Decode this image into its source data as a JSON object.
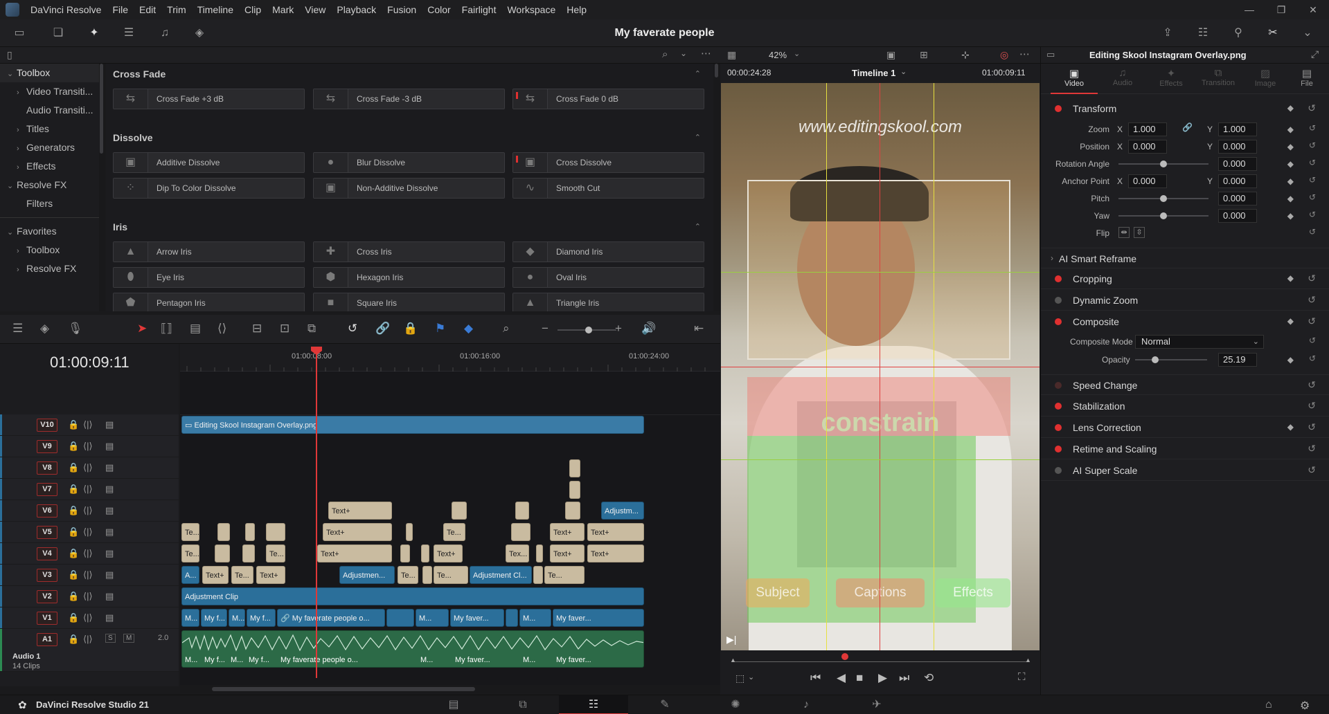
{
  "menu": {
    "app": "DaVinci Resolve",
    "items": [
      "File",
      "Edit",
      "Trim",
      "Timeline",
      "Clip",
      "Mark",
      "View",
      "Playback",
      "Fusion",
      "Color",
      "Fairlight",
      "Workspace",
      "Help"
    ]
  },
  "project_title": "My faverate people",
  "sidebar": {
    "toolbox": "Toolbox",
    "items": [
      "Video Transiti...",
      "Audio Transiti...",
      "Titles",
      "Generators",
      "Effects"
    ],
    "resolve_fx": "Resolve FX",
    "filters": "Filters",
    "favorites": "Favorites",
    "fav_items": [
      "Toolbox",
      "Resolve FX"
    ]
  },
  "transitions": {
    "cross_fade": {
      "title": "Cross Fade",
      "items": [
        "Cross Fade +3 dB",
        "Cross Fade -3 dB",
        "Cross Fade 0 dB"
      ]
    },
    "dissolve": {
      "title": "Dissolve",
      "items": [
        "Additive Dissolve",
        "Blur Dissolve",
        "Cross Dissolve",
        "Dip To Color Dissolve",
        "Non-Additive Dissolve",
        "Smooth Cut"
      ]
    },
    "iris": {
      "title": "Iris",
      "items": [
        "Arrow Iris",
        "Cross Iris",
        "Diamond Iris",
        "Eye Iris",
        "Hexagon Iris",
        "Oval Iris",
        "Pentagon Iris",
        "Square Iris",
        "Triangle Iris"
      ]
    }
  },
  "timeline": {
    "timecode": "01:00:09:11",
    "ruler": [
      "01:00:08:00",
      "01:00:16:00",
      "01:00:24:00"
    ],
    "tracks": [
      "V10",
      "V9",
      "V8",
      "V7",
      "V6",
      "V5",
      "V4",
      "V3",
      "V2",
      "V1",
      "A1"
    ],
    "audio_name": "Audio 1",
    "audio_clips": "14 Clips",
    "audio_level": "2.0",
    "solo": "S",
    "mute": "M",
    "v10_clip": "Editing Skool Instagram Overlay.png",
    "v2_clip": "Adjustment Clip",
    "text_label": "Text+",
    "adj_short": "Adjustm...",
    "adj_short2": "Adjustmen...",
    "adj_short3": "Adjustment Cl...",
    "v1_main": "My faverate people o...",
    "v1_short": "My faver...",
    "v1_myf": "My f...",
    "v1_m": "M...",
    "v3_a": "A...",
    "te": "Te...",
    "tex": "Tex..."
  },
  "viewer": {
    "zoom": "42%",
    "left_tc": "00:00:24:28",
    "timeline_name": "Timeline 1",
    "right_tc": "01:00:09:11",
    "watermark": "www.editingskool.com",
    "overlay_buttons": [
      "Subject",
      "Captions",
      "Effects"
    ],
    "shirt_text": "constrain"
  },
  "inspector": {
    "clip_name": "Editing Skool Instagram Overlay.png",
    "tabs": [
      "Video",
      "Audio",
      "Effects",
      "Transition",
      "Image",
      "File"
    ],
    "transform": "Transform",
    "zoom_label": "Zoom",
    "zoom_x": "1.000",
    "zoom_y": "1.000",
    "position_label": "Position",
    "pos_x": "0.000",
    "pos_y": "0.000",
    "rotation_label": "Rotation Angle",
    "rotation": "0.000",
    "anchor_label": "Anchor Point",
    "anchor_x": "0.000",
    "anchor_y": "0.000",
    "pitch_label": "Pitch",
    "pitch": "0.000",
    "yaw_label": "Yaw",
    "yaw": "0.000",
    "flip_label": "Flip",
    "x": "X",
    "y": "Y",
    "ai_reframe": "AI Smart Reframe",
    "cropping": "Cropping",
    "dynamic_zoom": "Dynamic Zoom",
    "composite": "Composite",
    "composite_mode_label": "Composite Mode",
    "composite_mode": "Normal",
    "opacity_label": "Opacity",
    "opacity": "25.19",
    "speed_change": "Speed Change",
    "stabilization": "Stabilization",
    "lens_correction": "Lens Correction",
    "retime": "Retime and Scaling",
    "super_scale": "AI Super Scale"
  },
  "status": {
    "app_name": "DaVinci Resolve Studio 21"
  },
  "colors": {
    "accent_red": "#e03030",
    "clip_blue": "#2b6f9a",
    "text_clip": "#c9bba0",
    "audio_green": "#2c6a47"
  }
}
